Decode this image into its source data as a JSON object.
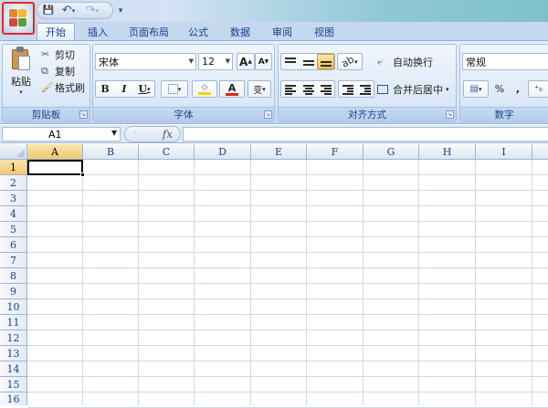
{
  "quick_access": {
    "save": "💾",
    "undo": "↶",
    "redo": "↷",
    "customize": "▾"
  },
  "tabs": [
    "开始",
    "插入",
    "页面布局",
    "公式",
    "数据",
    "审阅",
    "视图"
  ],
  "clipboard": {
    "paste": "粘贴",
    "cut": "剪切",
    "copy": "复制",
    "format_painter": "格式刷",
    "group": "剪贴板"
  },
  "font": {
    "name": "宋体",
    "size": "12",
    "grow": "A",
    "shrink": "A",
    "bold": "B",
    "italic": "I",
    "underline": "U",
    "phonetic": "变",
    "color_letter": "A",
    "group": "字体"
  },
  "alignment": {
    "wrap_text": "自动换行",
    "merge_center": "合并后居中",
    "group": "对齐方式"
  },
  "number": {
    "format": "常规",
    "percent": "%",
    "comma": ",",
    "decimal": "⁺₀",
    "group": "数字"
  },
  "formula_bar": {
    "name_box": "A1",
    "fx": "fx"
  },
  "columns": [
    "A",
    "B",
    "C",
    "D",
    "E",
    "F",
    "G",
    "H",
    "I"
  ],
  "rows": [
    "1",
    "2",
    "3",
    "4",
    "5",
    "6",
    "7",
    "8",
    "9",
    "10",
    "11",
    "12",
    "13",
    "14",
    "15",
    "16"
  ],
  "selected_cell": "A1",
  "colors": {
    "highlight_fill": "#f5d500",
    "font_color": "#e02020",
    "accent": "#15428b"
  }
}
